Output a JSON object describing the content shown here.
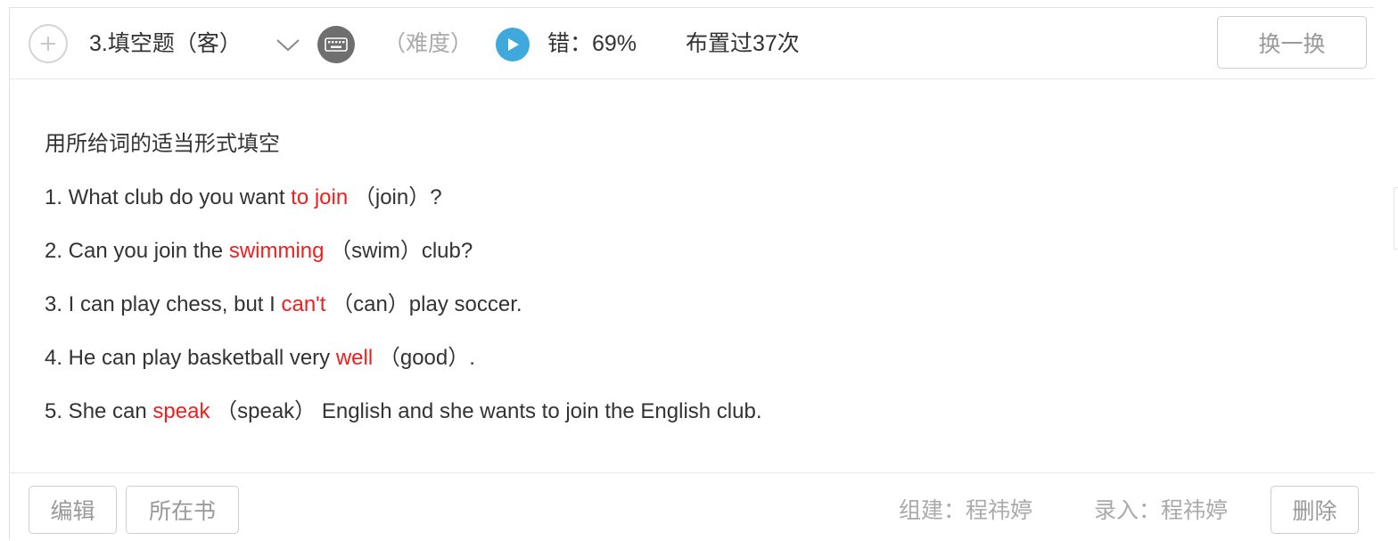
{
  "header": {
    "question_title": "3.填空题（客）",
    "difficulty": "（难度）",
    "error_rate": "错：69%",
    "assigned_count": "布置过37次",
    "swap_label": "换一换"
  },
  "question": {
    "instruction": "用所给词的适当形式填空",
    "items": [
      {
        "before": "1. What club do you want ",
        "answer": "to join",
        "after": " （join）?"
      },
      {
        "before": "2. Can you join the ",
        "answer": "swimming",
        "after": " （swim）club?"
      },
      {
        "before": "3. I can play chess, but I ",
        "answer": "can't",
        "after": " （can）play soccer."
      },
      {
        "before": "4. He can play basketball very ",
        "answer": "well",
        "after": " （good）."
      },
      {
        "before": "5. She can ",
        "answer": "speak",
        "after": " （speak） English and she wants to join the English club."
      }
    ]
  },
  "footer": {
    "edit_label": "编辑",
    "book_label": "所在书",
    "builder": "组建：程祎婷",
    "entry": "录入：程祎婷",
    "delete_label": "删除"
  },
  "colors": {
    "answer": "#f01e1e",
    "accent": "#3fa9dc",
    "muted": "#aaaaaa"
  },
  "icons": [
    "plus-icon",
    "chevron-down-icon",
    "keyboard-icon",
    "play-icon"
  ]
}
